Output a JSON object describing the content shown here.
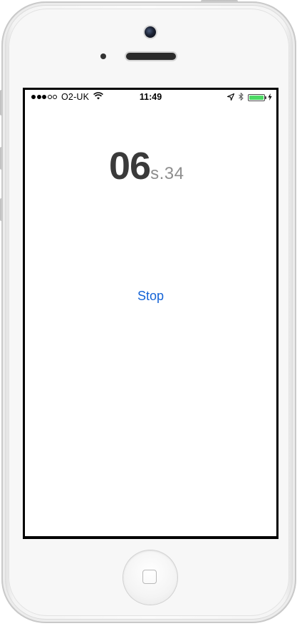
{
  "status_bar": {
    "carrier": "O2-UK",
    "time": "11:49",
    "signal_bars_filled": 3,
    "signal_bars_total": 5,
    "battery_level": 1.0,
    "battery_color": "#4cd964",
    "icons": [
      "wifi-icon",
      "location-arrow-icon",
      "bluetooth-icon",
      "battery-icon",
      "charging-bolt-icon"
    ]
  },
  "stopwatch": {
    "seconds": "06",
    "fraction": "s.34"
  },
  "controls": {
    "stop_label": "Stop"
  },
  "colors": {
    "accent": "#1463d6",
    "timer_text": "#3a3a3a",
    "timer_sub": "#8e8e8e"
  }
}
